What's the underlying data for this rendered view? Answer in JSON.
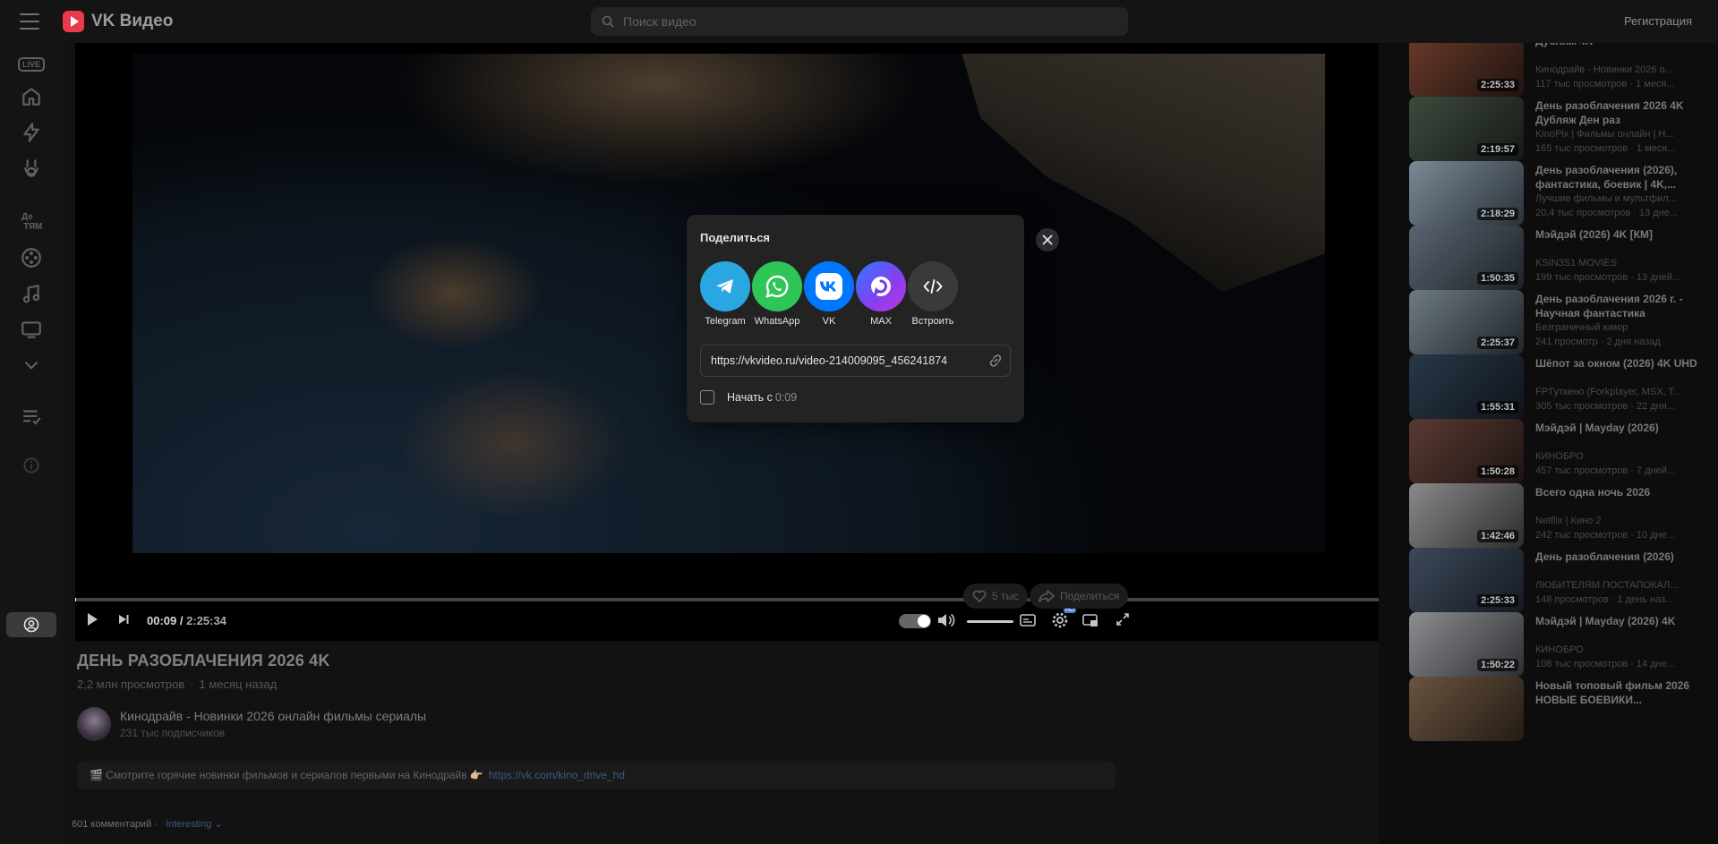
{
  "header": {
    "logo_text": "VK Видео",
    "search_placeholder": "Поиск видео",
    "register_label": "Регистрация"
  },
  "player": {
    "current_time": "00:09",
    "total_time": "2:25:34",
    "progress_fraction": 0.001
  },
  "video": {
    "title": "ДЕНЬ РАЗОБЛАЧЕНИЯ 2026 4K",
    "views": "2,2 млн просмотров",
    "date": "1 месяц назад",
    "channel_name": "Кинодрайв - Новинки 2026 онлайн фильмы сериалы",
    "subscribers": "231 тыс подписчиков",
    "likes": "5 тыс",
    "share_label": "Поделиться",
    "description": "🎬 Смотрите горячие новинки фильмов и сериалов первыми на Кинодрайв 👉🏼",
    "description_link": "https://vk.com/kino_drive_hd",
    "comments_count": "601 комментарий",
    "comments_sort": "Interesting"
  },
  "share_modal": {
    "title": "Поделиться",
    "options": [
      {
        "label": "Telegram",
        "icon": "telegram-icon",
        "color": "#2aa6e0"
      },
      {
        "label": "WhatsApp",
        "icon": "whatsapp-icon",
        "color": "#2ec559"
      },
      {
        "label": "VK",
        "icon": "vk-icon",
        "color": "#0077ff"
      },
      {
        "label": "MAX",
        "icon": "max-icon",
        "color": "#6a3cf0"
      },
      {
        "label": "Встроить",
        "icon": "embed-icon",
        "color": "#3a3a3c"
      }
    ],
    "url": "https://vkvideo.ru/video-214009095_456241874",
    "start_label": "Начать с",
    "start_time": "0:09"
  },
  "recommendations": [
    {
      "title": "Дубляж 4K",
      "channel": "Кинодрайв - Новинки 2026 о...",
      "views": "117 тыс просмотров · 1 меся...",
      "duration": "2:25:33"
    },
    {
      "title": "День разоблачения 2026 4K Дубляж Ден раз",
      "channel": "KinoPix | Фильмы онлайн | Н...",
      "views": "165 тыс просмотров · 1 меся...",
      "duration": "2:19:57"
    },
    {
      "title": "День разоблачения (2026), фантастика, боевик | 4K,...",
      "channel": "Лучшие фильмы и мультфил...",
      "views": "20,4 тыс просмотров · 13 дне...",
      "duration": "2:18:29"
    },
    {
      "title": "Мэйдэй (2026) 4K [КМ]",
      "channel": "KSIN3S1 MOVIES",
      "views": "199 тыс просмотров · 13 дней...",
      "duration": "1:50:35"
    },
    {
      "title": "День разоблачения 2026 г. - Научная фантастика",
      "channel": "Безграничный юмор",
      "views": "241 просмотр · 2 дня назад",
      "duration": "2:25:37"
    },
    {
      "title": "Шёпот за окном (2026) 4K UHD",
      "channel": "FPTуткено (Forkplayer, MSX, T...",
      "views": "305 тыс просмотров · 22 дня...",
      "duration": "1:55:31"
    },
    {
      "title": "Мэйдэй | Mayday (2026)",
      "channel": "КИНОБРО",
      "views": "457 тыс просмотров · 7 дней...",
      "duration": "1:50:28"
    },
    {
      "title": "Всего одна ночь 2026",
      "channel": "Netflix | Кино 2",
      "views": "242 тыс просмотров · 10 дне...",
      "duration": "1:42:46"
    },
    {
      "title": "День разоблачения (2026)",
      "channel": "ЛЮБИТЕЛЯМ ПОСТАПОКАЛ...",
      "views": "148 просмотров · 1 день наз...",
      "duration": "2:25:33"
    },
    {
      "title": "Мэйдэй | Mayday (2026) 4K",
      "channel": "КИНОБРО",
      "views": "108 тыс просмотров · 14 дне...",
      "duration": "1:50:22"
    },
    {
      "title": "Новый топовый фильм 2026 НОВЫЕ БОЕВИКИ...",
      "channel": "",
      "views": "",
      "duration": ""
    }
  ]
}
